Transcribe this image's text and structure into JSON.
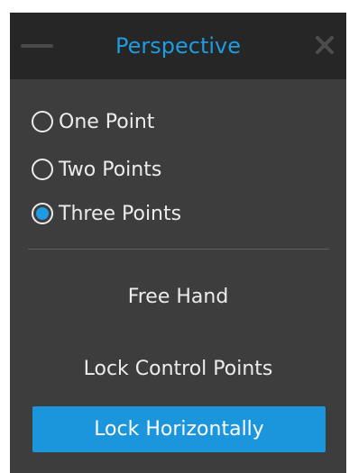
{
  "window": {
    "title": "Perspective"
  },
  "icons": {
    "minimize": "minimize-icon",
    "close": "close-icon"
  },
  "perspective_mode": {
    "options": [
      {
        "label": "One Point",
        "checked": false
      },
      {
        "label": "Two Points",
        "checked": false
      },
      {
        "label": "Three Points",
        "checked": true
      }
    ]
  },
  "actions": {
    "free_hand": "Free Hand",
    "lock_control_points": "Lock Control Points",
    "lock_horizontally": "Lock Horizontally"
  },
  "colors": {
    "accent": "#1e9be1",
    "panel_bg": "#3d3d3d",
    "titlebar_bg": "#262626",
    "text": "#ececec"
  }
}
